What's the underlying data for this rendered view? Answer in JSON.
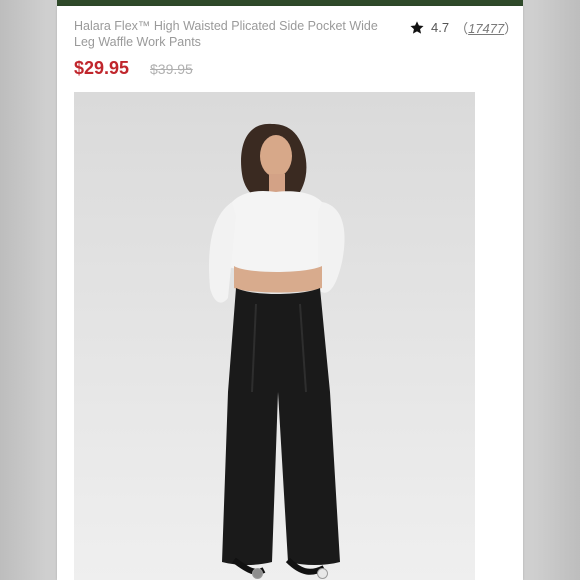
{
  "product": {
    "title": "Halara Flex™ High Waisted Plicated Side Pocket Wide Leg Waffle Work Pants",
    "rating": "4.7",
    "review_count": "17477",
    "price": "$29.95",
    "original_price": "$39.95",
    "photo_alt": "Model wearing white cropped long-sleeve top and black high-waisted wide leg pants"
  },
  "gallery": {
    "dot_count": 2,
    "active_index": 0
  },
  "colors": {
    "price": "#c0262c",
    "accent_strip": "#2f4a2a",
    "pants": "#1a1a1a",
    "top": "#f4f4f4"
  }
}
